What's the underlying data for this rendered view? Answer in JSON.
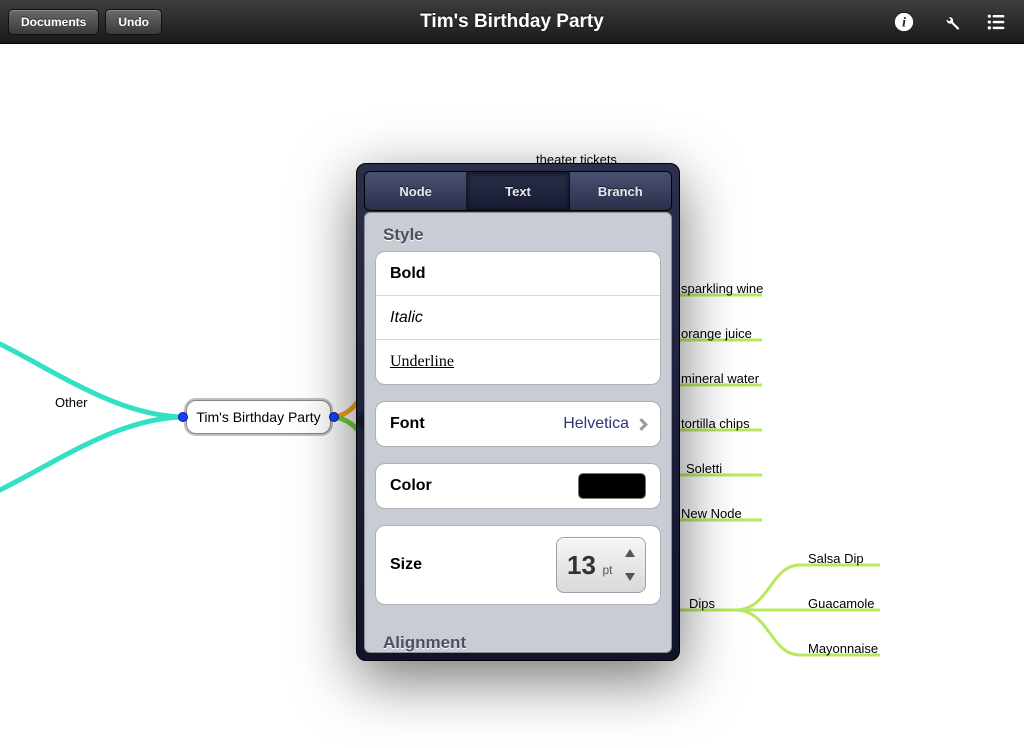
{
  "toolbar": {
    "documents_label": "Documents",
    "undo_label": "Undo",
    "title": "Tim's Birthday Party"
  },
  "mindmap": {
    "root": "Tim's Birthday Party",
    "left_node": "Other",
    "top_node": "theater tickets",
    "right_nodes": [
      "sparkling wine",
      "orange juice",
      "mineral water",
      "tortilla chips",
      "Soletti",
      "New Node"
    ],
    "dips_label": "Dips",
    "dips_children": [
      "Salsa Dip",
      "Guacamole",
      "Mayonnaise"
    ]
  },
  "popover": {
    "tabs": {
      "node": "Node",
      "text": "Text",
      "branch": "Branch"
    },
    "active_tab": "text",
    "sections": {
      "style_header": "Style",
      "style_bold": "Bold",
      "style_italic": "Italic",
      "style_underline": "Underline",
      "font_label": "Font",
      "font_value": "Helvetica",
      "color_label": "Color",
      "color_value": "#000000",
      "size_label": "Size",
      "size_value": "13",
      "size_unit": "pt",
      "alignment_header": "Alignment"
    }
  }
}
